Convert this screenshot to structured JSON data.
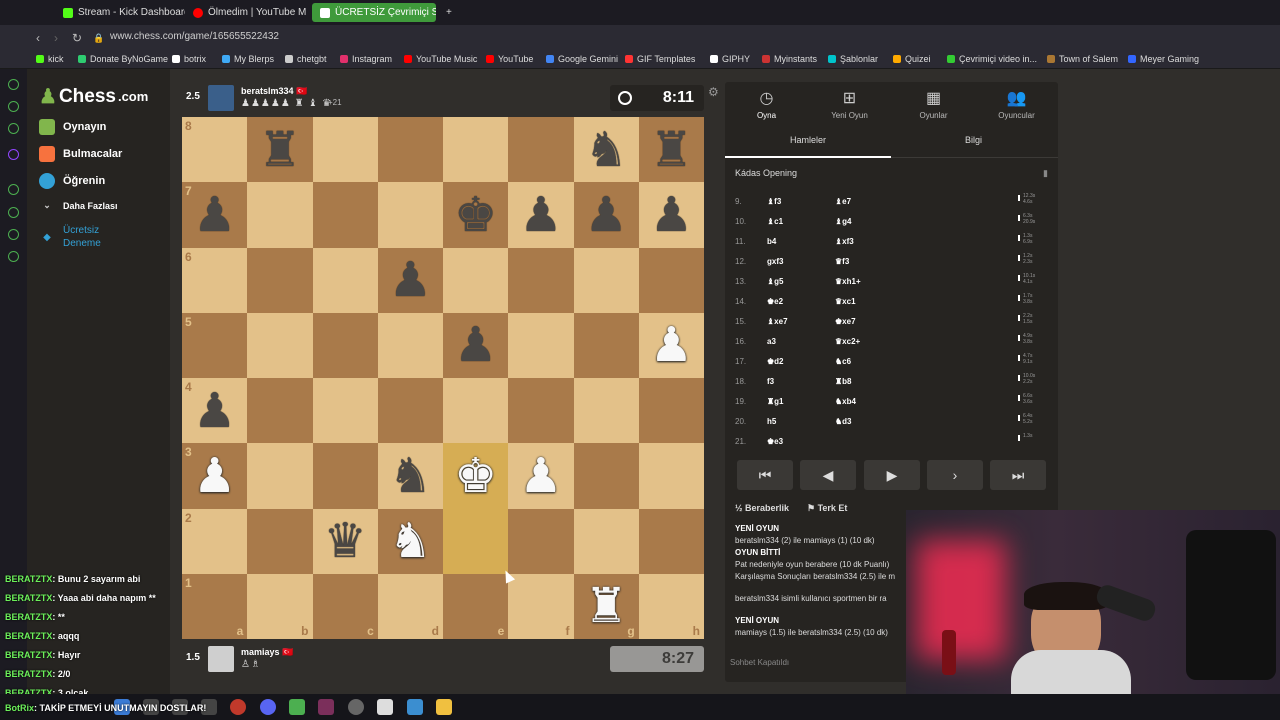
{
  "browser": {
    "tabs": [
      {
        "label": "Stream - Kick Dashboard",
        "color": "#53fc18"
      },
      {
        "label": "Ölmedim | YouTube M",
        "color": "#ff0000"
      },
      {
        "label": "ÜCRETSİZ Çevrimiçi S",
        "color": "#81b64c"
      }
    ],
    "url": "www.chess.com/game/165655522432",
    "bookmarks": [
      {
        "label": "kick",
        "color": "#53fc18"
      },
      {
        "label": "Donate ByNoGame",
        "color": "#2ecc71"
      },
      {
        "label": "botrix",
        "color": "#ffffff"
      },
      {
        "label": "My Blerps",
        "color": "#3fa9f5"
      },
      {
        "label": "chetgbt",
        "color": "#cccccc"
      },
      {
        "label": "Instagram",
        "color": "#e1306c"
      },
      {
        "label": "YouTube Music",
        "color": "#ff0000"
      },
      {
        "label": "YouTube",
        "color": "#ff0000"
      },
      {
        "label": "Google Gemini",
        "color": "#4285f4"
      },
      {
        "label": "GIF Templates",
        "color": "#ff3333"
      },
      {
        "label": "GIPHY",
        "color": "#ffffff"
      },
      {
        "label": "Myinstants",
        "color": "#cc3333"
      },
      {
        "label": "Şablonlar",
        "color": "#00c4cc"
      },
      {
        "label": "Quizei",
        "color": "#ffaa00"
      },
      {
        "label": "Çevrimiçi video in...",
        "color": "#33cc33"
      },
      {
        "label": "Town of Salem",
        "color": "#aa7733"
      },
      {
        "label": "Meyer Gaming",
        "color": "#3366ff"
      }
    ]
  },
  "site": {
    "logo": "Chess",
    "logo_suffix": ".com",
    "nav": [
      {
        "label": "Oynayın",
        "color": "#81b64c"
      },
      {
        "label": "Bulmacalar",
        "color": "#f7723e"
      },
      {
        "label": "Öğrenin",
        "color": "#33a1d6"
      },
      {
        "label": "Daha Fazlası",
        "color": "#888888"
      },
      {
        "label": "Ücretsiz Deneme",
        "color": "#33a1d6"
      }
    ]
  },
  "top_player": {
    "score": "2.5",
    "name": "beratslm334",
    "flag": "🇹🇷",
    "captured": "♟♟♟♟♟ ♜ ♝ ♛",
    "material": "+21",
    "clock": "8:11"
  },
  "bottom_player": {
    "score": "1.5",
    "name": "mamiays",
    "flag": "🇹🇷",
    "captured": "♙♗",
    "clock": "8:27"
  },
  "board": {
    "ranks": [
      "8",
      "7",
      "6",
      "5",
      "4",
      "3",
      "2",
      "1"
    ],
    "files": [
      "a",
      "b",
      "c",
      "d",
      "e",
      "f",
      "g",
      "h"
    ],
    "position": [
      [
        "",
        "bR",
        "",
        "",
        "",
        "",
        "bN",
        "bR"
      ],
      [
        "bP",
        "",
        "",
        "",
        "bK",
        "bP",
        "bP",
        "bP"
      ],
      [
        "",
        "",
        "",
        "bP",
        "",
        "",
        "",
        ""
      ],
      [
        "",
        "",
        "",
        "",
        "bP",
        "",
        "",
        "wP"
      ],
      [
        "bP",
        "",
        "",
        "",
        "",
        "",
        "",
        ""
      ],
      [
        "wP",
        "",
        "",
        "bN",
        "wK",
        "wP",
        "",
        ""
      ],
      [
        "",
        "",
        "bQ",
        "wN",
        "",
        "",
        "",
        ""
      ],
      [
        "",
        "",
        "",
        "",
        "",
        "",
        "wR",
        ""
      ]
    ],
    "highlight": [
      [
        5,
        4
      ],
      [
        6,
        4
      ]
    ]
  },
  "panel": {
    "tabs": [
      {
        "label": "Oyna",
        "icon": "clock-icon"
      },
      {
        "label": "Yeni Oyun",
        "icon": "plus-icon"
      },
      {
        "label": "Oyunlar",
        "icon": "board-icon"
      },
      {
        "label": "Oyuncular",
        "icon": "people-icon"
      }
    ],
    "subtabs": [
      "Hamleler",
      "Bilgi"
    ],
    "opening": "Kádas Opening",
    "moves": [
      {
        "n": "9.",
        "w": "♝f3",
        "b": "♝e7",
        "t1": "12.3s",
        "t2": "4.6s"
      },
      {
        "n": "10.",
        "w": "♝c1",
        "b": "♝g4",
        "t1": "6.3s",
        "t2": "20.9s"
      },
      {
        "n": "11.",
        "w": "b4",
        "b": "♝xf3",
        "t1": "1.3s",
        "t2": "6.9s"
      },
      {
        "n": "12.",
        "w": "gxf3",
        "b": "♛f3",
        "t1": "1.2s",
        "t2": "2.3s"
      },
      {
        "n": "13.",
        "w": "♝g5",
        "b": "♛xh1+",
        "t1": "10.1s",
        "t2": "4.1s"
      },
      {
        "n": "14.",
        "w": "♚e2",
        "b": "♛xc1",
        "t1": "1.7s",
        "t2": "3.8s"
      },
      {
        "n": "15.",
        "w": "♝xe7",
        "b": "♚xe7",
        "t1": "2.2s",
        "t2": "1.5s"
      },
      {
        "n": "16.",
        "w": "a3",
        "b": "♛xc2+",
        "t1": "4.9s",
        "t2": "3.8s"
      },
      {
        "n": "17.",
        "w": "♚d2",
        "b": "♞c6",
        "t1": "4.7s",
        "t2": "9.1s"
      },
      {
        "n": "18.",
        "w": "f3",
        "b": "♜b8",
        "t1": "10.0s",
        "t2": "2.2s"
      },
      {
        "n": "19.",
        "w": "♜g1",
        "b": "♞xb4",
        "t1": "6.6s",
        "t2": "3.6s"
      },
      {
        "n": "20.",
        "w": "h5",
        "b": "♞d3",
        "t1": "6.4s",
        "t2": "5.2s"
      },
      {
        "n": "21.",
        "w": "♚e3",
        "b": "",
        "t1": "1.3s",
        "t2": ""
      }
    ],
    "controls": [
      "⏮",
      "◀",
      "▶",
      "▷",
      "⏭"
    ],
    "draw": "Beraberlik",
    "resign": "Terk Et",
    "chat": [
      {
        "text": "YENİ OYUN",
        "head": true
      },
      {
        "text": "beratslm334 (2) ile mamiays (1) (10 dk)",
        "head": false
      },
      {
        "text": "OYUN BİTTİ",
        "head": true
      },
      {
        "text": "Pat nedeniyle oyun berabere (10 dk Puanlı)",
        "head": false
      },
      {
        "text": "Karşılaşma Sonuçları beratslm334 (2.5) ile m",
        "head": false
      },
      {
        "text": "beratslm334 isimli kullanıcı sportmen bir ra",
        "head": false
      },
      {
        "text": "YENİ OYUN",
        "head": true
      },
      {
        "text": "mamiays (1.5) ile beratslm334 (2.5) (10 dk)",
        "head": false
      }
    ],
    "chat_closed": "Sohbet Kapatıldı"
  },
  "stream_chat": [
    {
      "name": "BERATZTX",
      "msg": ": Bunu 2 sayarım abi"
    },
    {
      "name": "BERATZTX",
      "msg": ": Yaaa abi daha napım **"
    },
    {
      "name": "BERATZTX",
      "msg": ": **"
    },
    {
      "name": "BERATZTX",
      "msg": ": aqqq"
    },
    {
      "name": "BERATZTX",
      "msg": ": Hayır"
    },
    {
      "name": "BERATZTX",
      "msg": ": 2/0"
    },
    {
      "name": "BERATZTX",
      "msg": ": 3 olcak"
    }
  ],
  "ticker": {
    "name": "BotRix",
    "msg": ": TAKİP ETMEYİ UNUTMAYIN DOSTLAR!"
  }
}
